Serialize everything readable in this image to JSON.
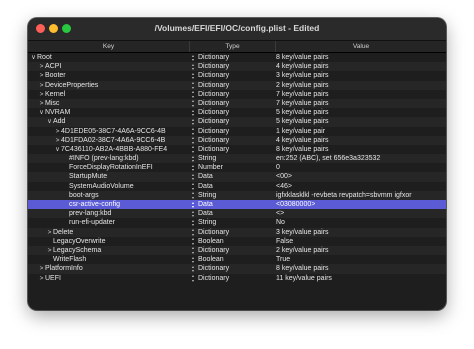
{
  "window": {
    "title": "/Volumes/EFI/EFI/OC/config.plist - Edited"
  },
  "columns": {
    "key": "Key",
    "type": "Type",
    "value": "Value"
  },
  "rows": [
    {
      "key": "Root",
      "type": "Dictionary",
      "value": "8 key/value pairs",
      "depth": 0,
      "disc": "open"
    },
    {
      "key": "ACPI",
      "type": "Dictionary",
      "value": "4 key/value pairs",
      "depth": 1,
      "disc": "closed"
    },
    {
      "key": "Booter",
      "type": "Dictionary",
      "value": "3 key/value pairs",
      "depth": 1,
      "disc": "closed"
    },
    {
      "key": "DeviceProperties",
      "type": "Dictionary",
      "value": "2 key/value pairs",
      "depth": 1,
      "disc": "closed"
    },
    {
      "key": "Kernel",
      "type": "Dictionary",
      "value": "7 key/value pairs",
      "depth": 1,
      "disc": "closed"
    },
    {
      "key": "Misc",
      "type": "Dictionary",
      "value": "7 key/value pairs",
      "depth": 1,
      "disc": "closed"
    },
    {
      "key": "NVRAM",
      "type": "Dictionary",
      "value": "5 key/value pairs",
      "depth": 1,
      "disc": "open"
    },
    {
      "key": "Add",
      "type": "Dictionary",
      "value": "5 key/value pairs",
      "depth": 2,
      "disc": "open"
    },
    {
      "key": "4D1EDE05-38C7-4A6A-9CC6-4B",
      "type": "Dictionary",
      "value": "1 key/value pair",
      "depth": 3,
      "disc": "closed"
    },
    {
      "key": "4D1FDA02-38C7-4A6A-9CC6-4B",
      "type": "Dictionary",
      "value": "4 key/value pairs",
      "depth": 3,
      "disc": "closed"
    },
    {
      "key": "7C436110-AB2A-4BBB-A880-FE4",
      "type": "Dictionary",
      "value": "8 key/value pairs",
      "depth": 3,
      "disc": "open"
    },
    {
      "key": "#INFO (prev-lang:kbd)",
      "type": "String",
      "value": "en:252 (ABC), set 656e3a323532",
      "depth": 4,
      "disc": "none"
    },
    {
      "key": "ForceDisplayRotationInEFI",
      "type": "Number",
      "value": "0",
      "depth": 4,
      "disc": "none"
    },
    {
      "key": "StartupMute",
      "type": "Data",
      "value": "<00>",
      "depth": 4,
      "disc": "none"
    },
    {
      "key": "SystemAudioVolume",
      "type": "Data",
      "value": "<46>",
      "depth": 4,
      "disc": "none"
    },
    {
      "key": "boot-args",
      "type": "String",
      "value": "igfxklasklkl -revbeta revpatch=sbvmm igfxor",
      "depth": 4,
      "disc": "none"
    },
    {
      "key": "csr-active-config",
      "type": "Data",
      "value": "<03080000>",
      "depth": 4,
      "disc": "none",
      "selected": true
    },
    {
      "key": "prev-lang:kbd",
      "type": "Data",
      "value": "<>",
      "depth": 4,
      "disc": "none"
    },
    {
      "key": "run-efi-updater",
      "type": "String",
      "value": "No",
      "depth": 4,
      "disc": "none"
    },
    {
      "key": "Delete",
      "type": "Dictionary",
      "value": "3 key/value pairs",
      "depth": 2,
      "disc": "closed"
    },
    {
      "key": "LegacyOverwrite",
      "type": "Boolean",
      "value": "False",
      "depth": 2,
      "disc": "none"
    },
    {
      "key": "LegacySchema",
      "type": "Dictionary",
      "value": "2 key/value pairs",
      "depth": 2,
      "disc": "closed"
    },
    {
      "key": "WriteFlash",
      "type": "Boolean",
      "value": "True",
      "depth": 2,
      "disc": "none"
    },
    {
      "key": "PlatformInfo",
      "type": "Dictionary",
      "value": "8 key/value pairs",
      "depth": 1,
      "disc": "closed"
    },
    {
      "key": "UEFI",
      "type": "Dictionary",
      "value": "11 key/value pairs",
      "depth": 1,
      "disc": "closed"
    }
  ],
  "colors": {
    "selection": "#5b5bd6",
    "background": "#1e1e1e",
    "alt_row": "#262626"
  },
  "icons": {
    "open": "chevron-down-icon",
    "closed": "chevron-right-icon",
    "type_stepper": "up-down-stepper-icon"
  }
}
